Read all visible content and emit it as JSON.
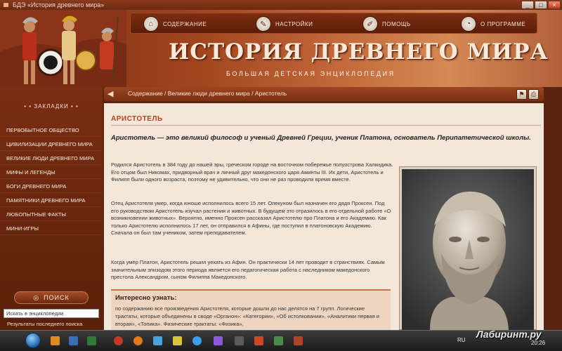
{
  "window": {
    "title": "БДЭ «История древнего мира»"
  },
  "nav": {
    "contents": "СОДЕРЖАНИЕ",
    "settings": "НАСТРОЙКИ",
    "help": "ПОМОЩЬ",
    "about": "О ПРОГРАММЕ"
  },
  "header": {
    "title": "ИСТОРИЯ ДРЕВНЕГО МИРА",
    "subtitle": "БОЛЬШАЯ ДЕТСКАЯ ЭНЦИКЛОПЕДИЯ"
  },
  "breadcrumb": "Содержание / Великие люди древнего мира / Аристотель",
  "sidebar": {
    "heading": "• • ЗАКЛАДКИ • •",
    "items": [
      "ПЕРВОБЫТНОЕ ОБЩЕСТВО",
      "ЦИВИЛИЗАЦИИ ДРЕВНЕГО МИРА",
      "ВЕЛИКИЕ ЛЮДИ ДРЕВНЕГО МИРА",
      "МИФЫ И ЛЕГЕНДЫ",
      "БОГИ ДРЕВНЕГО МИРА",
      "ПАМЯТНИКИ ДРЕВНЕГО МИРА",
      "ЛЮБОПЫТНЫЕ ФАКТЫ",
      "МИНИ-ИГРЫ"
    ],
    "search_label": "ПОИСК",
    "search_value": "Искать в энциклопедии",
    "last_results": "Результаты последнего поиска"
  },
  "article": {
    "title": "АРИСТОТЕЛЬ",
    "lead": "Аристотель — это великий философ и ученый Древней Греции, ученик Платона, основатель Перипатетической школы.",
    "p1": "Родился Аристотель в 384 году до нашей эры, греческом городе на восточном побережье полуострова Халкидика. Его отцом был Никомах, придворный врач и личный друг македонского царя Аминты III. Их дети, Аристотель и Филипп были одного возраста, поэтому не удивительно, что они не раз проводили время вместе.",
    "p2": "Отец Аристотеля умер, когда юноше исполнилось всего 15 лет. Опекуном был назначен его дядя Проксен. Под его руководством Аристотель изучал растения и животных. В будущем это отразилось в его отдельной работе «О возникновении животных». Вероятно, именно Проксен рассказал Аристотелю про Платона и его Академию. Как только Аристотелю исполнилось 17 лет, он отправился в Афины, где поступил в платоновскую Академию. Сначала он был там учеником, затем преподавателем.",
    "p3": "Когда умер Платон, Аристотель решил уехать из Афин. Он практически 14 лет проводит в странствиях. Самым значительным эпизодом этого периода является его педагогическая работа с наследником македонского престола Александром, сыном Филиппа Македонского.",
    "info_title": "Интересно узнать:",
    "info_text": "по содержанию все произведения Аристотеля, которые дошли до нас делятся на 7 групп. Логические трактаты, которые объединены в своде «Органон»: «Категории», «Об истолковании», «Аналитики первая и вторая», «Топика». Физические трактаты: «Физика»,"
  },
  "taskbar": {
    "lang": "RU",
    "watermark": "Лабиринт.ру",
    "time": "20:26"
  }
}
